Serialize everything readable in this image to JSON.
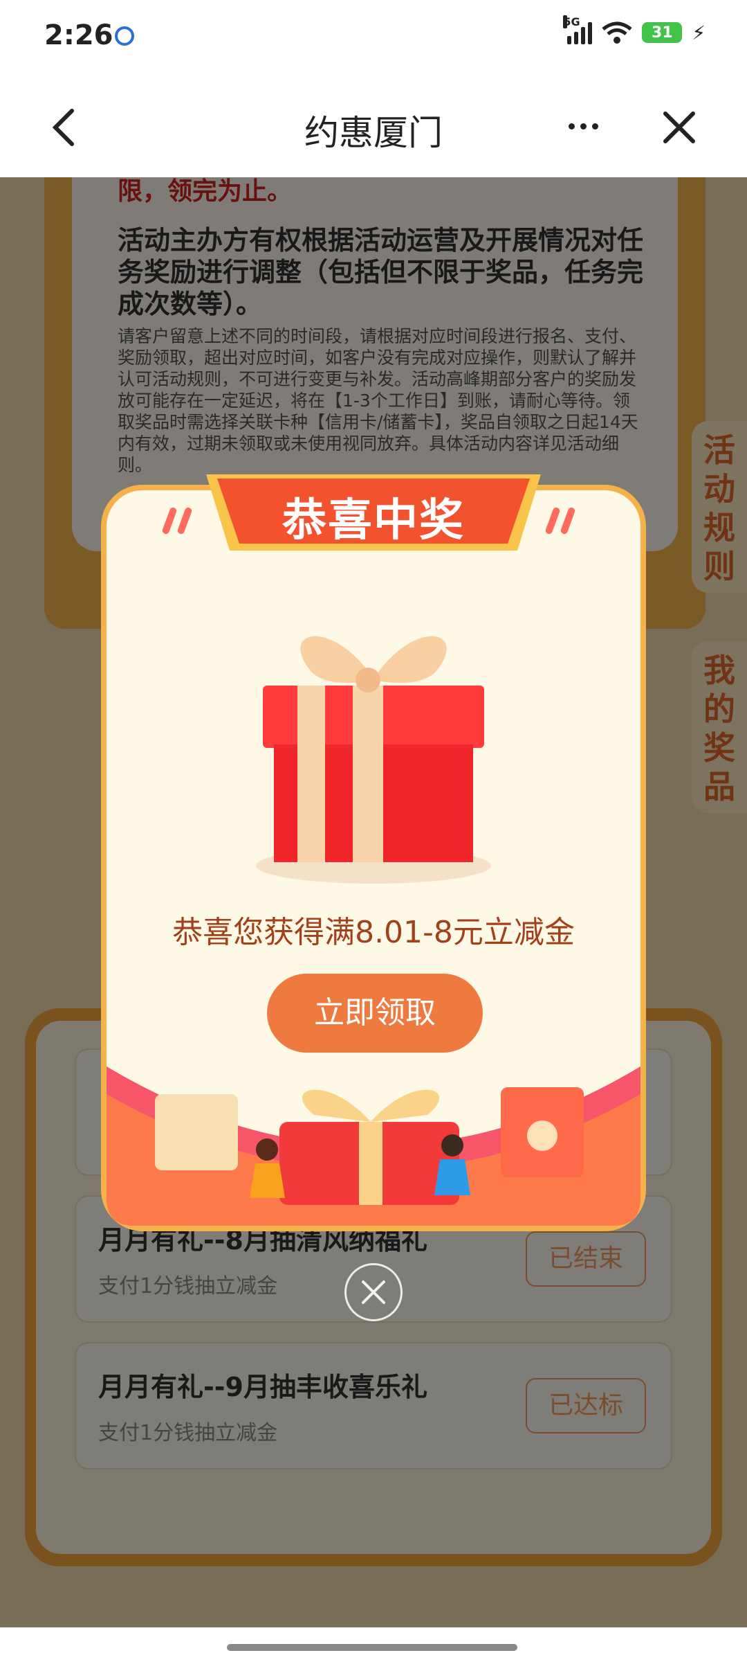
{
  "status_bar": {
    "time": "2:26",
    "network": "5G",
    "battery": "31"
  },
  "nav": {
    "title": "约惠厦门"
  },
  "rules": {
    "red_text": "限，领完为止。",
    "bold_text": "活动主办方有权根据活动运营及开展情况对任务奖励进行调整（包括但不限于奖品，任务完成次数等）。",
    "small_text": "请客户留意上述不同的时间段，请根据对应时间段进行报名、支付、奖励领取，超出对应时间，如客户没有完成对应操作，则默认了解并认可活动规则，不可进行变更与补发。活动高峰期部分客户的奖励发放可能存在一定延迟，将在【1-3个工作日】到账，请耐心等待。领取奖品时需选择关联卡种【信用卡/储蓄卡】，奖品自领取之日起14天内有效，过期未领取或未使用视同放弃。具体活动内容详见活动细则。"
  },
  "side_tabs": [
    "活动规则",
    "我的奖品"
  ],
  "tasks": [
    {
      "title": "月月有礼--8月抽清风纳福礼",
      "subtitle": "支付1分钱抽立减金",
      "status": "已结束"
    },
    {
      "title": "月月有礼--9月抽丰收喜乐礼",
      "subtitle": "支付1分钱抽立减金",
      "status": "已达标"
    }
  ],
  "popup": {
    "title": "恭喜中奖",
    "prize_text": "恭喜您获得满8.01-8元立减金",
    "claim_button": "立即领取"
  },
  "colors": {
    "accent": "#ef7a3f",
    "popup_border": "#f6b24a",
    "ribbon": "#f2522e",
    "prize_text": "#a3401c"
  }
}
